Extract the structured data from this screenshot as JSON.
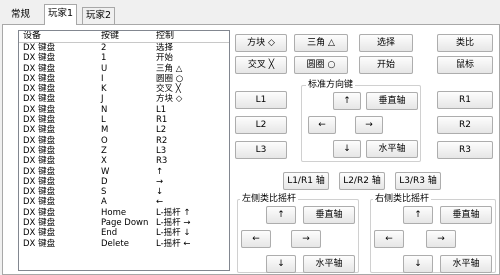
{
  "tabs": [
    {
      "label": "常规"
    },
    {
      "label": "玩家1"
    },
    {
      "label": "玩家2"
    }
  ],
  "mapping_list": {
    "headers": {
      "device": "设备",
      "key": "按键",
      "control": "控制"
    },
    "rows": [
      {
        "device": "DX 键盘",
        "key": "2",
        "control": "选择"
      },
      {
        "device": "DX 键盘",
        "key": "1",
        "control": "开始"
      },
      {
        "device": "DX 键盘",
        "key": "U",
        "control": "三角 △"
      },
      {
        "device": "DX 键盘",
        "key": "I",
        "control": "圆圈 ○"
      },
      {
        "device": "DX 键盘",
        "key": "K",
        "control": "交叉 ╳"
      },
      {
        "device": "DX 键盘",
        "key": "J",
        "control": "方块 ◇"
      },
      {
        "device": "DX 键盘",
        "key": "N",
        "control": "L1"
      },
      {
        "device": "DX 键盘",
        "key": "L",
        "control": "R1"
      },
      {
        "device": "DX 键盘",
        "key": "M",
        "control": "L2"
      },
      {
        "device": "DX 键盘",
        "key": "O",
        "control": "R2"
      },
      {
        "device": "DX 键盘",
        "key": "Z",
        "control": "L3"
      },
      {
        "device": "DX 键盘",
        "key": "X",
        "control": "R3"
      },
      {
        "device": "DX 键盘",
        "key": "W",
        "control": "↑"
      },
      {
        "device": "DX 键盘",
        "key": "D",
        "control": "→"
      },
      {
        "device": "DX 键盘",
        "key": "S",
        "control": "↓"
      },
      {
        "device": "DX 键盘",
        "key": "A",
        "control": "←"
      },
      {
        "device": "DX 键盘",
        "key": "Home",
        "control": "L-摇杆 ↑"
      },
      {
        "device": "DX 键盘",
        "key": "Page Down",
        "control": "L-摇杆 →"
      },
      {
        "device": "DX 键盘",
        "key": "End",
        "control": "L-摇杆 ↓"
      },
      {
        "device": "DX 键盘",
        "key": "Delete",
        "control": "L-摇杆 ←"
      }
    ]
  },
  "buttons": {
    "square": "方块 ◇",
    "triangle": "三角 △",
    "select": "选择",
    "analog": "类比",
    "cross": "交叉 ╳",
    "circle": "圆圈 ○",
    "start": "开始",
    "mouse": "鼠标",
    "l1": "L1",
    "r1": "R1",
    "l2": "L2",
    "r2": "R2",
    "l3": "L3",
    "r3": "R3",
    "l1r1_axis": "L1/R1 轴",
    "l2r2_axis": "L2/R2 轴",
    "l3r3_axis": "L3/R3 轴"
  },
  "dpad_group": {
    "title": "标准方向键",
    "up": "↑",
    "left": "←",
    "right": "→",
    "down": "↓",
    "vertical_axis": "垂直轴",
    "horizontal_axis": "水平轴"
  },
  "left_stick_group": {
    "title": "左侧类比摇杆",
    "up": "↑",
    "left": "←",
    "right": "→",
    "down": "↓",
    "vertical_axis": "垂直轴",
    "horizontal_axis": "水平轴"
  },
  "right_stick_group": {
    "title": "右侧类比摇杆",
    "up": "↑",
    "left": "←",
    "right": "→",
    "down": "↓",
    "vertical_axis": "垂直轴",
    "horizontal_axis": "水平轴"
  }
}
